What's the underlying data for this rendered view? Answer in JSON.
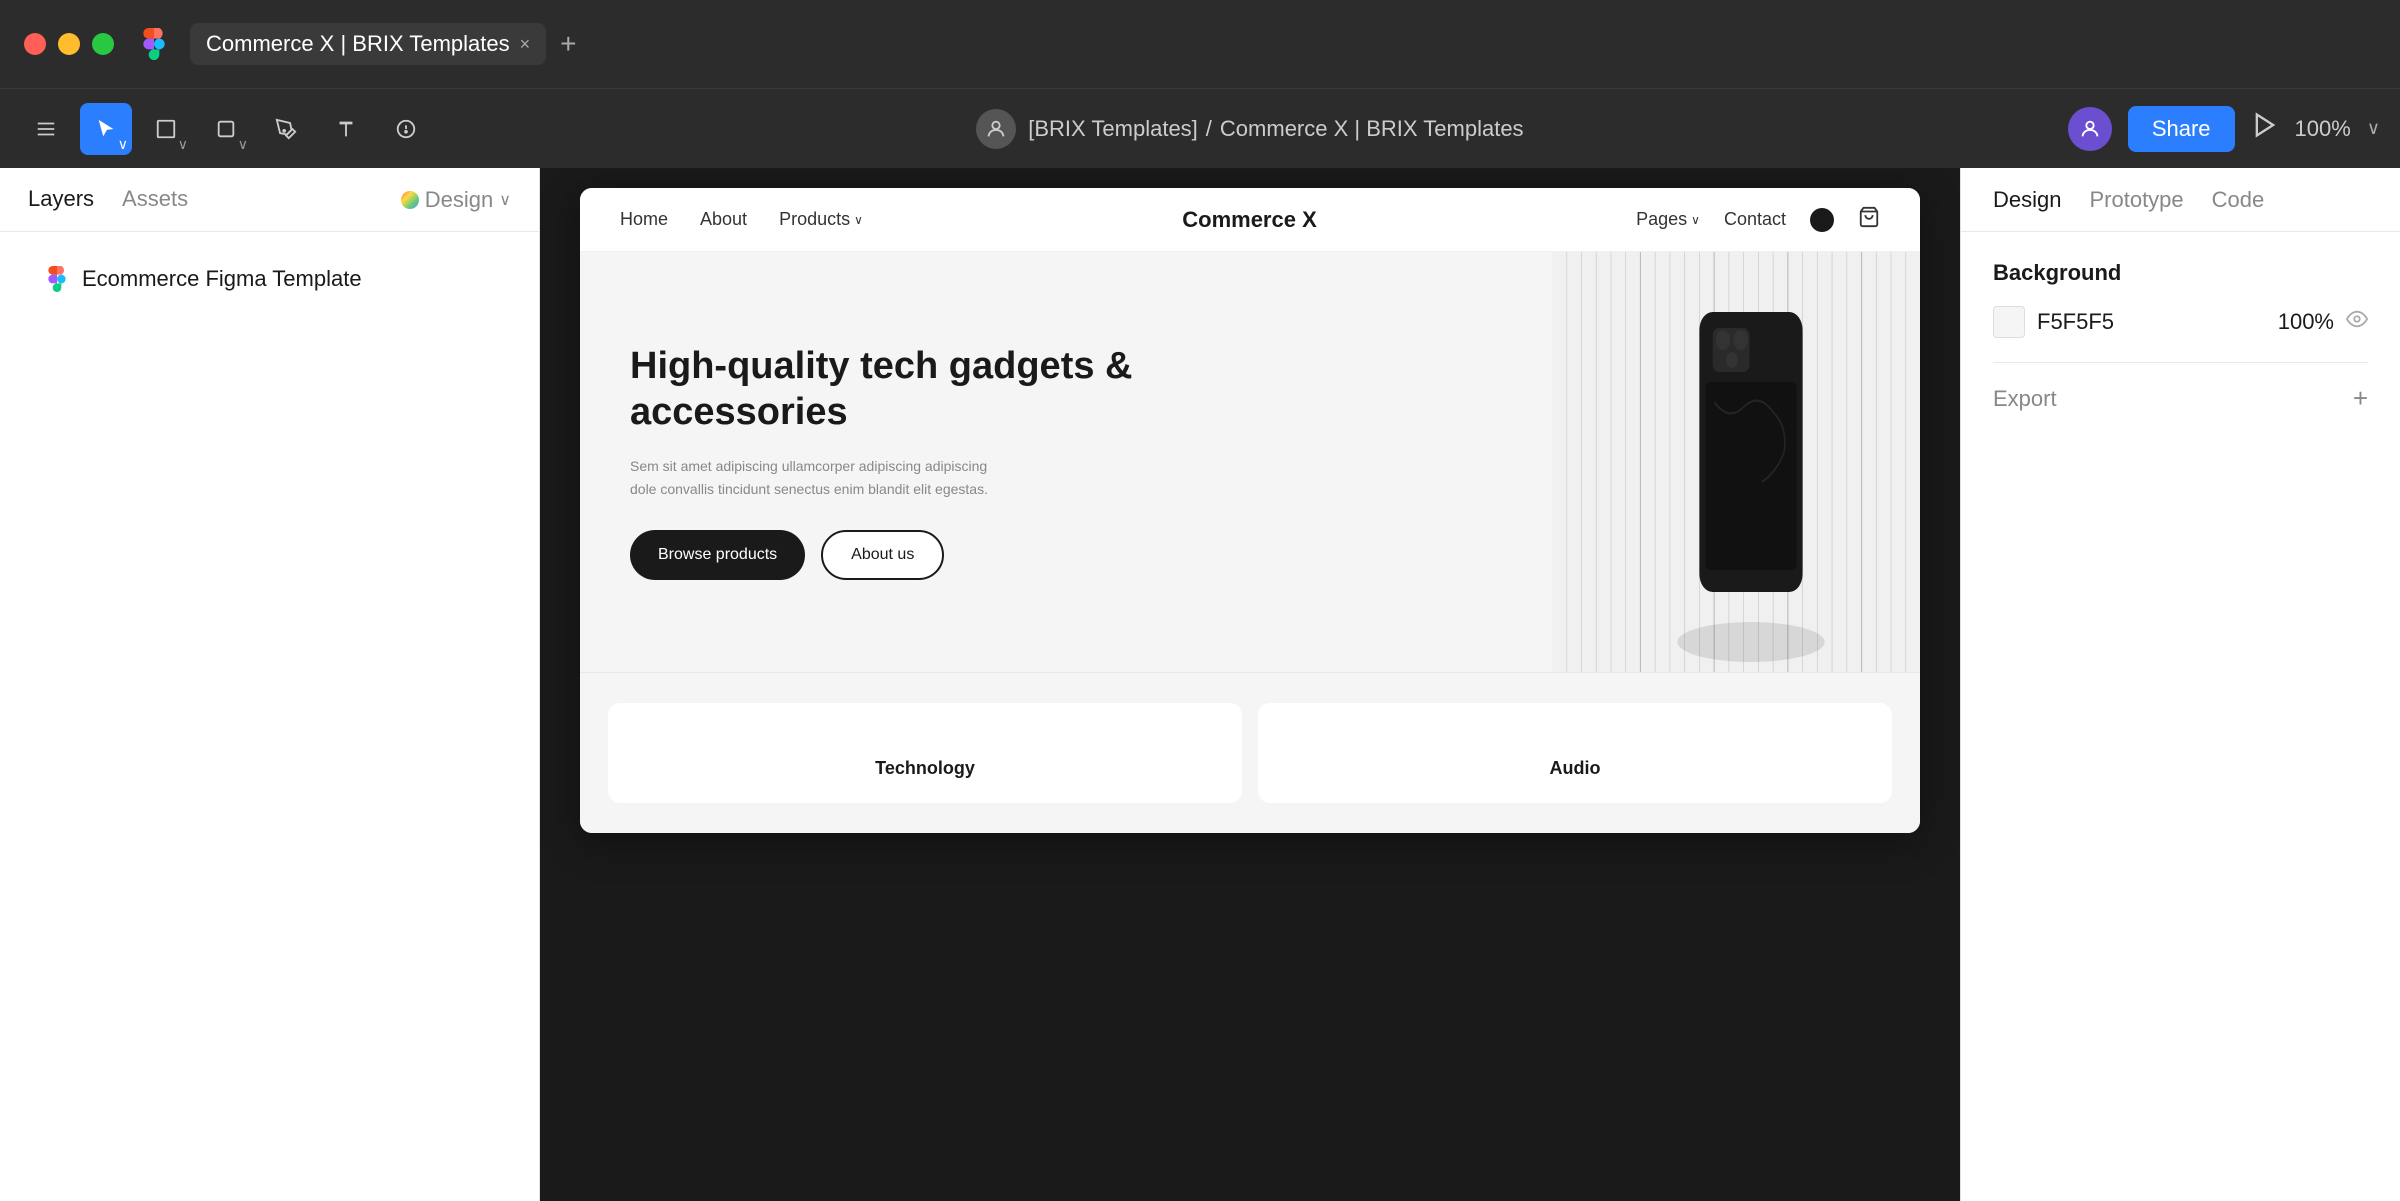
{
  "titlebar": {
    "tab_title": "Commerce X | BRIX Templates",
    "tab_close": "×",
    "tab_add": "+"
  },
  "toolbar": {
    "breadcrumb_user": "[BRIX Templates]",
    "breadcrumb_sep": "/",
    "breadcrumb_project": "Commerce X | BRIX Templates",
    "share_label": "Share",
    "zoom_label": "100%"
  },
  "left_panel": {
    "tab_layers": "Layers",
    "tab_assets": "Assets",
    "tab_design": "Design",
    "layer_name": "Ecommerce Figma Template"
  },
  "right_panel": {
    "tab_design": "Design",
    "tab_prototype": "Prototype",
    "tab_code": "Code",
    "background_label": "Background",
    "bg_color": "F5F5F5",
    "bg_opacity": "100%",
    "export_label": "Export",
    "export_plus": "+"
  },
  "website": {
    "nav": {
      "home": "Home",
      "about": "About",
      "products": "Products",
      "logo": "Commerce X",
      "pages": "Pages",
      "contact": "Contact"
    },
    "hero": {
      "title": "High-quality tech gadgets & accessories",
      "subtitle": "Sem sit amet adipiscing ullamcorper adipiscing adipiscing dole convallis tincidunt senectus enim blandit elit egestas.",
      "btn_primary": "Browse products",
      "btn_secondary": "About us"
    },
    "cards": [
      {
        "label": "Technology"
      },
      {
        "label": "Audio"
      }
    ]
  },
  "icons": {
    "cursor": "↖",
    "frame": "#",
    "shape": "□",
    "pen": "✒",
    "text": "T",
    "comment": "○",
    "play": "▷",
    "eye": "👁",
    "chevron_down": "∨"
  }
}
